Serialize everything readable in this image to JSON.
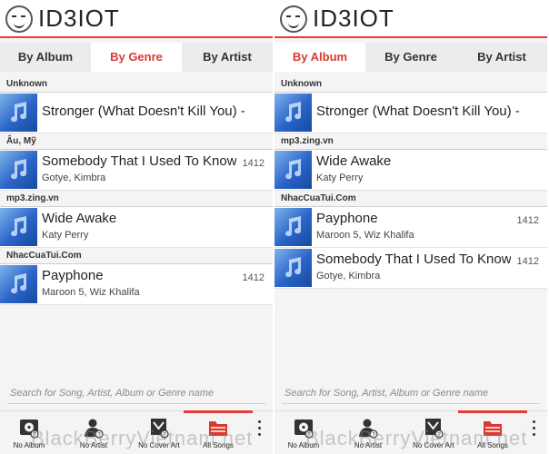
{
  "app": {
    "title": "ID3IOT"
  },
  "tabs": [
    "By Album",
    "By Genre",
    "By Artist"
  ],
  "left": {
    "active_tab": 1,
    "sections": [
      {
        "header": "Unknown",
        "items": [
          {
            "song": "Stronger (What Doesn't Kill You) -",
            "artist": "",
            "num": ""
          }
        ]
      },
      {
        "header": "Âu, Mỹ",
        "items": [
          {
            "song": "Somebody That I Used To Know",
            "artist": "Gotye, Kimbra",
            "num": "1412"
          }
        ]
      },
      {
        "header": "mp3.zing.vn",
        "items": [
          {
            "song": "Wide Awake",
            "artist": "Katy Perry",
            "num": ""
          }
        ]
      },
      {
        "header": "NhacCuaTui.Com",
        "items": [
          {
            "song": "Payphone",
            "artist": "Maroon 5, Wiz Khalifa",
            "num": "1412"
          }
        ]
      }
    ]
  },
  "right": {
    "active_tab": 0,
    "sections": [
      {
        "header": "Unknown",
        "items": [
          {
            "song": "Stronger (What Doesn't Kill You) -",
            "artist": "",
            "num": ""
          }
        ]
      },
      {
        "header": "mp3.zing.vn",
        "items": [
          {
            "song": "Wide Awake",
            "artist": "Katy Perry",
            "num": ""
          }
        ]
      },
      {
        "header": "NhacCuaTui.Com",
        "items": [
          {
            "song": "Payphone",
            "artist": "Maroon 5, Wiz Khalifa",
            "num": "1412"
          },
          {
            "song": "Somebody That I Used To Know",
            "artist": "Gotye, Kimbra",
            "num": "1412"
          }
        ]
      }
    ]
  },
  "search": {
    "placeholder": "Search for Song, Artist, Album or Genre name"
  },
  "actions": [
    {
      "label": "No Album",
      "icon": "album-icon"
    },
    {
      "label": "No Artist",
      "icon": "artist-icon"
    },
    {
      "label": "No Cover Art",
      "icon": "cover-art-icon"
    },
    {
      "label": "All Songs",
      "icon": "folder-icon"
    }
  ],
  "watermark": "BlackBerryVietnam.net",
  "colors": {
    "accent": "#e63b3b",
    "active_tab_text": "#d83a2f",
    "thumb": "#2a64c9"
  }
}
